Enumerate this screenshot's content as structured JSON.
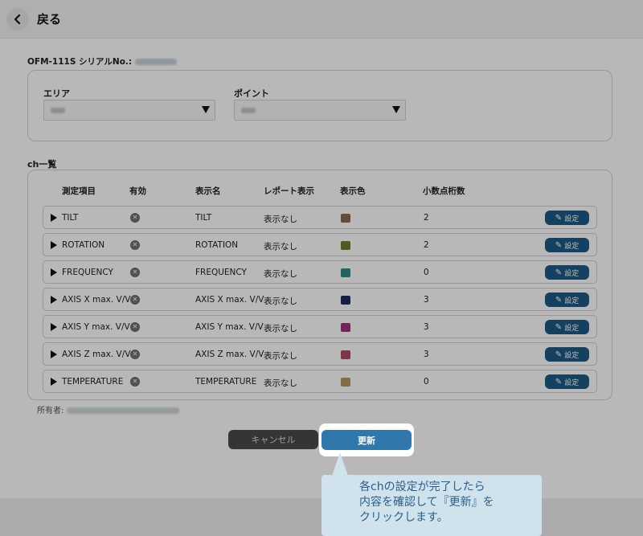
{
  "header": {
    "back_label": "戻る"
  },
  "device": {
    "serial_label": "OFM-111S シリアルNo.:"
  },
  "filters": {
    "area_label": "エリア",
    "point_label": "ポイント"
  },
  "channels": {
    "section_title": "ch一覧",
    "columns": [
      "測定項目",
      "有効",
      "表示名",
      "レポート表示",
      "表示色",
      "小数点桁数"
    ],
    "rows": [
      {
        "item": "TILT",
        "display_name": "TILT",
        "report": "表示なし",
        "color": "#8b6a55",
        "decimals": "2",
        "action": "設定"
      },
      {
        "item": "ROTATION",
        "display_name": "ROTATION",
        "report": "表示なし",
        "color": "#747a2e",
        "decimals": "2",
        "action": "設定"
      },
      {
        "item": "FREQUENCY",
        "display_name": "FREQUENCY",
        "report": "表示なし",
        "color": "#2e8a86",
        "decimals": "0",
        "action": "設定"
      },
      {
        "item": "AXIS X max. V/V",
        "display_name": "AXIS X max. V/V",
        "report": "表示なし",
        "color": "#1f2a5e",
        "decimals": "3",
        "action": "設定"
      },
      {
        "item": "AXIS Y max. V/V",
        "display_name": "AXIS Y max. V/V",
        "report": "表示なし",
        "color": "#a0307f",
        "decimals": "3",
        "action": "設定"
      },
      {
        "item": "AXIS Z max. V/V",
        "display_name": "AXIS Z max. V/V",
        "report": "表示なし",
        "color": "#b04a64",
        "decimals": "3",
        "action": "設定"
      },
      {
        "item": "TEMPERATURE",
        "display_name": "TEMPERATURE",
        "report": "表示なし",
        "color": "#b49a5a",
        "decimals": "0",
        "action": "設定"
      }
    ]
  },
  "owner_label": "所有者:",
  "buttons": {
    "cancel": "キャンセル",
    "update": "更新"
  },
  "callout": {
    "line1": "各chの設定が完了したら",
    "line2": "内容を確認して『更新』を",
    "line3": "クリックします。"
  }
}
